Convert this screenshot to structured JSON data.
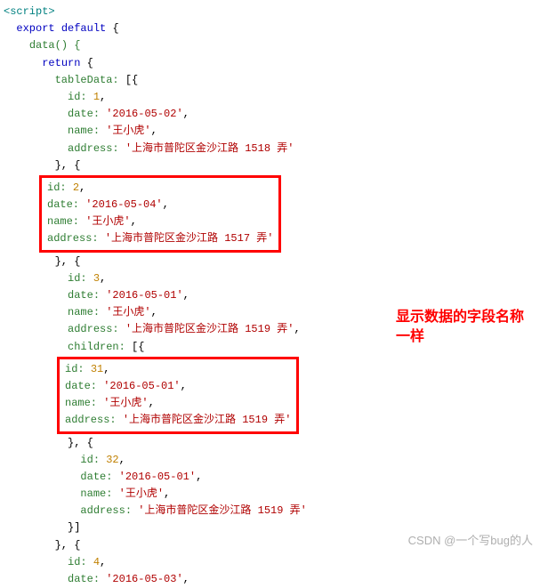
{
  "code": {
    "script_open": "<script>",
    "export_default": "export default",
    "data_fn": "data() {",
    "return": "return",
    "tableData_key": "tableData:",
    "id_key": "id:",
    "date_key": "date:",
    "name_key": "name:",
    "address_key": "address:",
    "children_key": "children:",
    "obj_close_comma": "}, {",
    "arr_open": "[{",
    "comma": ",",
    "open_brace": "{",
    "close_brace": "}"
  },
  "rows": {
    "r1": {
      "id": "1",
      "date": "'2016-05-02'",
      "name": "'王小虎'",
      "address": "'上海市普陀区金沙江路 1518 弄'"
    },
    "r2": {
      "id": "2",
      "date": "'2016-05-04'",
      "name": "'王小虎'",
      "address": "'上海市普陀区金沙江路 1517 弄'"
    },
    "r3": {
      "id": "3",
      "date": "'2016-05-01'",
      "name": "'王小虎'",
      "address": "'上海市普陀区金沙江路 1519 弄'"
    },
    "c31": {
      "id": "31",
      "date": "'2016-05-01'",
      "name": "'王小虎'",
      "address": "'上海市普陀区金沙江路 1519 弄'"
    },
    "c32": {
      "id": "32",
      "date": "'2016-05-01'",
      "name": "'王小虎'",
      "address": "'上海市普陀区金沙江路 1519 弄'"
    },
    "r4": {
      "id": "4",
      "date": "'2016-05-03'"
    }
  },
  "annotation": {
    "line1": "显示数据的字段名称",
    "line2": "一样"
  },
  "watermark": "CSDN @一个写bug的人"
}
